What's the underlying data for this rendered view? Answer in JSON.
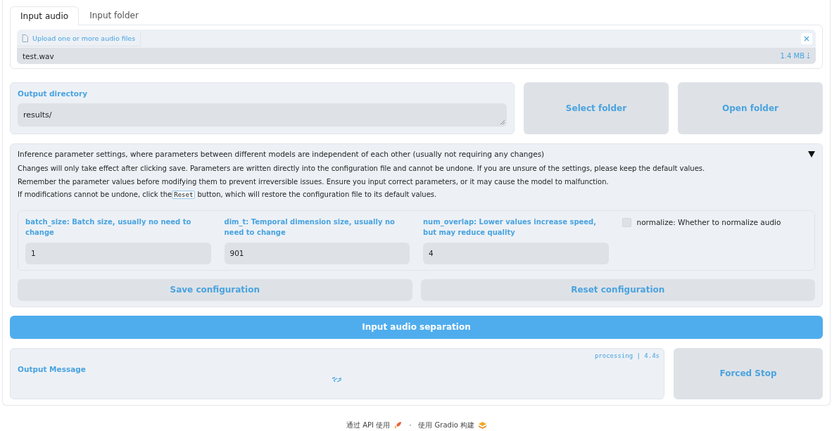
{
  "tabs": [
    {
      "label": "Input audio",
      "selected": true
    },
    {
      "label": "Input folder",
      "selected": false
    }
  ],
  "upload": {
    "label": "Upload one or more audio files",
    "files": [
      {
        "name": "test.wav",
        "size": "1.4 MB"
      }
    ]
  },
  "output_directory": {
    "label": "Output directory",
    "value": "results/"
  },
  "folder_buttons": [
    "Select folder",
    "Open folder"
  ],
  "accordion": {
    "title": "Inference parameter settings, where parameters between different models are independent of each other (usually not requiring any changes)",
    "expanded": true,
    "notes": [
      {
        "text": "Changes will only take effect after clicking save. Parameters are written directly into the configuration file and cannot be undone. If you are unsure of the settings, please keep the default values."
      },
      {
        "text": "Remember the parameter values before modifying them to prevent irreversible issues. Ensure you input correct parameters, or it may cause the model to malfunction."
      },
      {
        "text": "If modifications cannot be undone, click the",
        "code": "Reset",
        "after": "button, which will restore the configuration file to its default values."
      }
    ],
    "params": [
      {
        "kind": "number",
        "label": "batch_size: Batch size, usually no need to change",
        "value": "1"
      },
      {
        "kind": "number",
        "label": "dim_t: Temporal dimension size, usually no need to change",
        "value": "901"
      },
      {
        "kind": "number",
        "label": "num_overlap: Lower values increase speed, but may reduce quality",
        "value": "4"
      },
      {
        "kind": "checkbox",
        "label": "normalize: Whether to normalize audio",
        "checked": false
      }
    ],
    "buttons": [
      "Save configuration",
      "Reset configuration"
    ]
  },
  "run_button": "Input audio separation",
  "output": {
    "label": "Output Message",
    "status": "processing",
    "divider": "|",
    "time": "4.4s"
  },
  "stop_button": "Forced Stop",
  "footer": {
    "api": "通过 API 使用",
    "separator": "·",
    "built": "使用 Gradio 构建"
  }
}
